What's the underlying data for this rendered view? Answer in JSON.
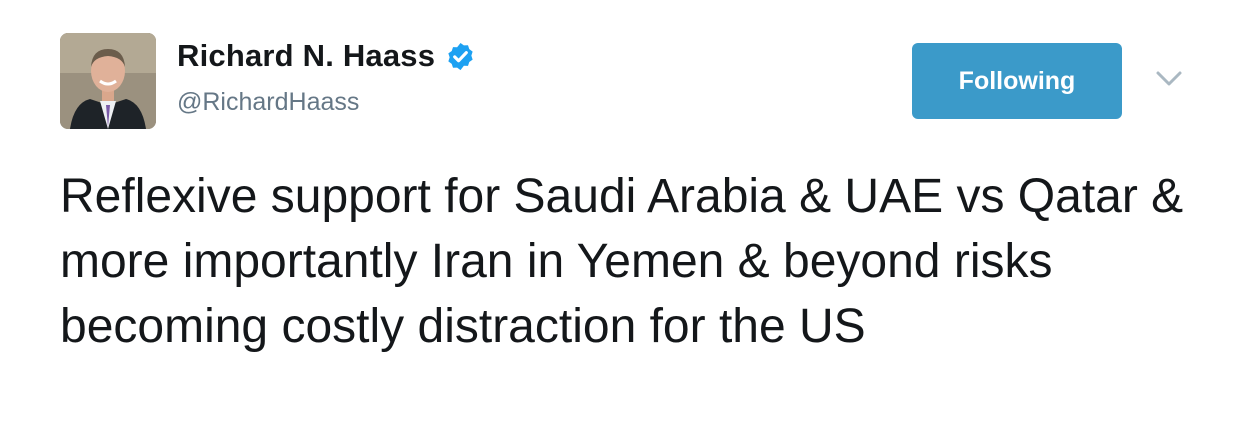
{
  "author": {
    "display_name": "Richard N. Haass",
    "handle": "@RichardHaass",
    "verified": true,
    "avatar_icon": "profile-photo"
  },
  "actions": {
    "follow_label": "Following",
    "menu_icon": "chevron-down-icon"
  },
  "tweet": {
    "text": "Reflexive support for Saudi Arabia & UAE vs Qatar & more importantly Iran in Yemen & beyond risks becoming costly distraction for the US"
  },
  "colors": {
    "accent": "#3b9ac9",
    "verified": "#1da1f2",
    "text": "#14171a",
    "muted": "#657786"
  }
}
